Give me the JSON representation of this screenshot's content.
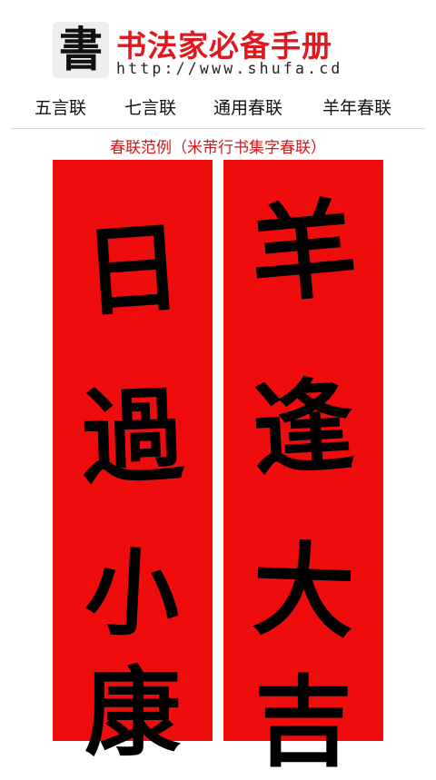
{
  "header": {
    "logo_char": "書",
    "title": "书法家必备手册",
    "url": "http://www.shufa.cd"
  },
  "nav": {
    "items": [
      {
        "label": "五言联"
      },
      {
        "label": "七言联"
      },
      {
        "label": "通用春联"
      },
      {
        "label": "羊年春联"
      }
    ]
  },
  "subtitle": "春联范例（米芾行书集字春联）",
  "couplet": {
    "left_chars": [
      "日",
      "過",
      "小",
      "康"
    ],
    "right_chars": [
      "羊",
      "逢",
      "大",
      "吉"
    ],
    "scroll_color": "#ee0c0c"
  }
}
